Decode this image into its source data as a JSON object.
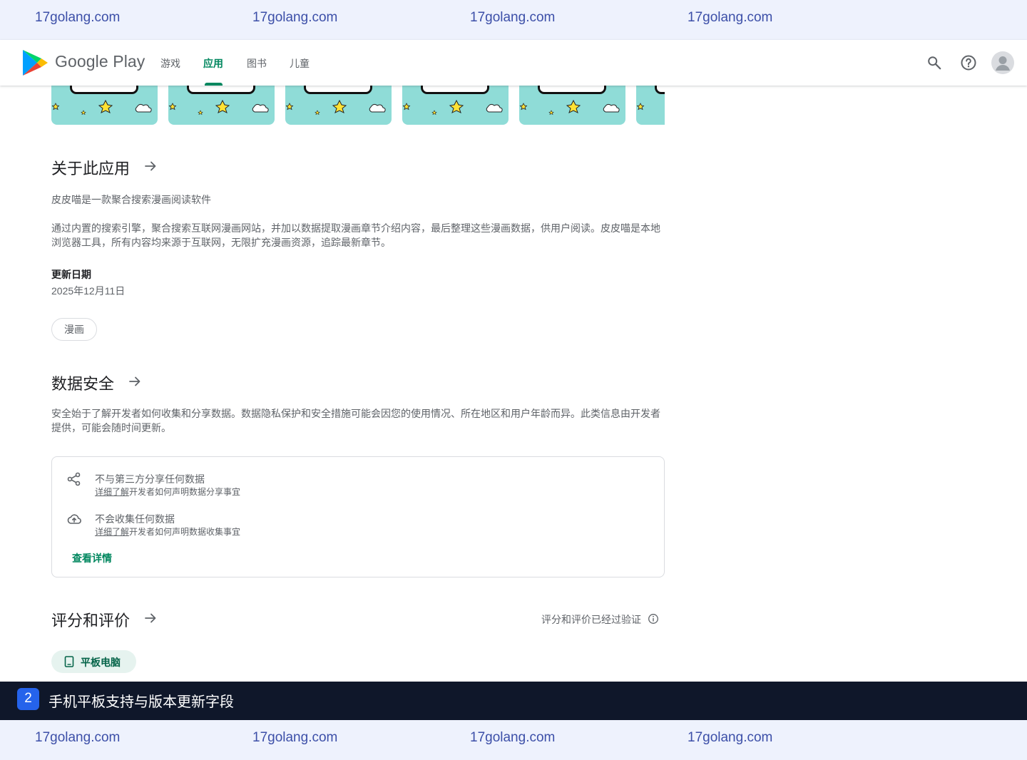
{
  "watermark": {
    "text": "17golang.com",
    "color": "#3c4fa8"
  },
  "header": {
    "brand": "Google Play",
    "nav": [
      "游戏",
      "应用",
      "图书",
      "儿童"
    ],
    "active_nav": "应用",
    "accent_color": "#01875f",
    "icons": [
      "search-icon",
      "help-icon",
      "account-avatar-icon"
    ]
  },
  "about": {
    "title": "关于此应用",
    "tagline": "皮皮喵是一款聚合搜索漫画阅读软件",
    "description": "通过内置的搜索引擎，聚合搜索互联网漫画网站，并加以数据提取漫画章节介绍内容，最后整理这些漫画数据，供用户阅读。皮皮喵是本地浏览器工具，所有内容均来源于互联网，无限扩充漫画资源，追踪最新章节。",
    "updated_label": "更新日期",
    "updated_value": "2025年12月11日",
    "tag": "漫画"
  },
  "data_safety": {
    "title": "数据安全",
    "description": "安全始于了解开发者如何收集和分享数据。数据隐私保护和安全措施可能会因您的使用情况、所在地区和用户年龄而异。此类信息由开发者提供，可能会随时间更新。",
    "rows": [
      {
        "icon": "share-icon",
        "main": "不与第三方分享任何数据",
        "link": "详细了解",
        "rest": "开发者如何声明数据分享事宜"
      },
      {
        "icon": "cloud-upload-icon",
        "main": "不会收集任何数据",
        "link": "详细了解",
        "rest": "开发者如何声明数据收集事宜"
      }
    ],
    "details_link": "查看详情"
  },
  "ratings": {
    "title": "评分和评价",
    "verified": "评分和评价已经过验证",
    "device_tab": "平板电脑"
  },
  "caption": {
    "number": "2",
    "text": "手机平板支持与版本更新字段"
  }
}
